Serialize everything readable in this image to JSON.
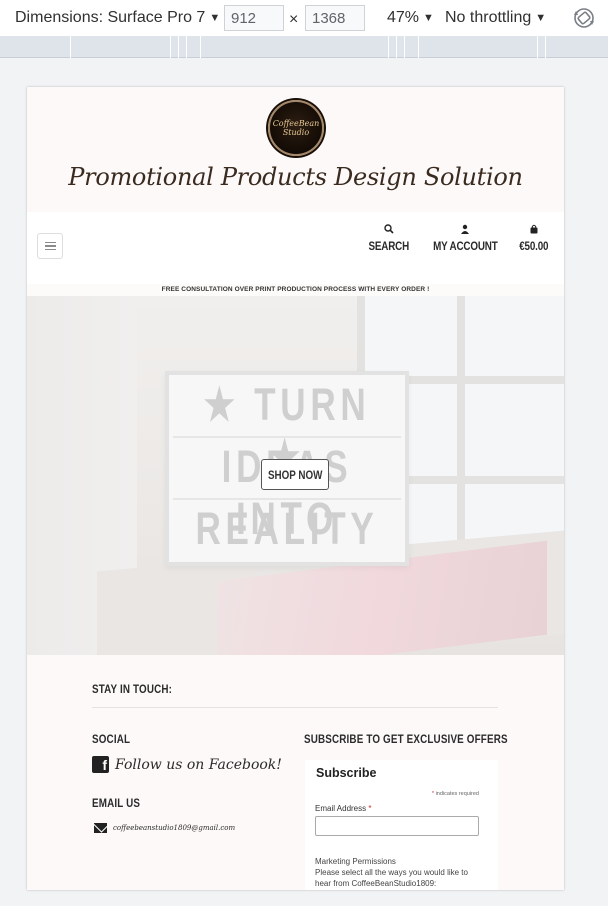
{
  "toolbar": {
    "device_label": "Dimensions: Surface Pro 7",
    "width_value": "912",
    "times": "×",
    "height_value": "1368",
    "zoom_label": "47%",
    "throttle_label": "No throttling",
    "caret": "▼",
    "rotate_icon": "rotate-icon"
  },
  "site": {
    "logo_text_1": "CoffeeBean",
    "logo_text_2": "Studio",
    "tagline": "Promotional Products Design Solution",
    "nav": {
      "search": "SEARCH",
      "account": "MY ACCOUNT",
      "cart": "€50.00"
    },
    "notice": "FREE CONSULTATION OVER PRINT PRODUCTION PROCESS WITH EVERY ORDER !",
    "hero": {
      "line1": "★ TURN ★",
      "line2": "IDEAS INTO",
      "line3": "REALITY",
      "button": "SHOP NOW"
    },
    "footer": {
      "stay_in_touch": "STAY IN TOUCH:",
      "social_heading": "SOCIAL",
      "facebook_link": "Follow us on Facebook!",
      "email_heading": "EMAIL US",
      "email": "coffeebeanstudio1809@gmail.com",
      "subscribe_heading": "SUBSCRIBE TO GET EXCLUSIVE OFFERS",
      "form": {
        "title": "Subscribe",
        "required_note": "indicates required",
        "asterisk": "*",
        "email_label": "Email Address",
        "email_value": "",
        "marketing_label": "Marketing Permissions",
        "marketing_text": "Please select all the ways you would like to hear from CoffeeBeanStudio1809:"
      }
    }
  },
  "colors": {
    "devtools_bg": "#f1f3f4",
    "mq_bar": "#dfe3ea",
    "site_bg": "#fcf9f8",
    "text_dark": "#2b2b2b",
    "required_red": "#d02a2a"
  }
}
